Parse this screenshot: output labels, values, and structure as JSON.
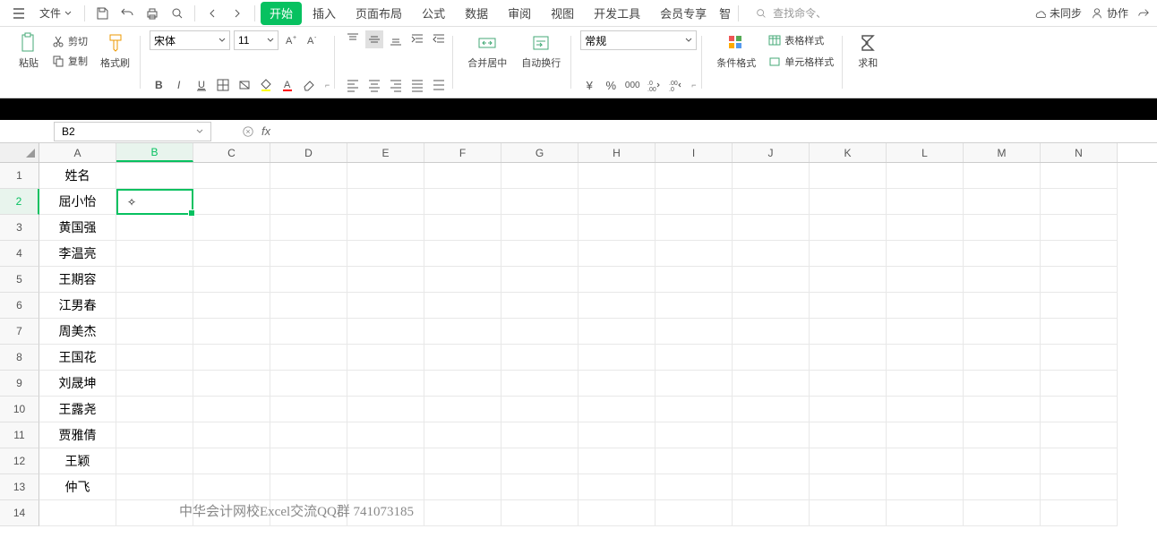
{
  "menubar": {
    "file": "文件",
    "tabs": [
      "开始",
      "插入",
      "页面布局",
      "公式",
      "数据",
      "审阅",
      "视图",
      "开发工具",
      "会员专享"
    ],
    "active_tab": 0,
    "overflow": "智",
    "search_placeholder": "查找命令、",
    "unsync": "未同步",
    "collab": "协作"
  },
  "ribbon": {
    "paste": "粘贴",
    "cut": "剪切",
    "copy": "复制",
    "format_painter": "格式刷",
    "font_name": "宋体",
    "font_size": "11",
    "merge_center": "合并居中",
    "wrap": "自动换行",
    "number_format": "常规",
    "cond_fmt": "条件格式",
    "table_style": "表格样式",
    "cell_style": "单元格样式",
    "sum": "求和"
  },
  "formula_bar": {
    "name_box": "B2",
    "fx": "fx",
    "value": ""
  },
  "grid": {
    "columns": [
      "A",
      "B",
      "C",
      "D",
      "E",
      "F",
      "G",
      "H",
      "I",
      "J",
      "K",
      "L",
      "M",
      "N"
    ],
    "active_col": "B",
    "active_row": 2,
    "rows": [
      {
        "num": 1,
        "A": "姓名"
      },
      {
        "num": 2,
        "A": "屈小怡"
      },
      {
        "num": 3,
        "A": "黄国强"
      },
      {
        "num": 4,
        "A": "李温亮"
      },
      {
        "num": 5,
        "A": "王期容"
      },
      {
        "num": 6,
        "A": "江男春"
      },
      {
        "num": 7,
        "A": "周美杰"
      },
      {
        "num": 8,
        "A": "王国花"
      },
      {
        "num": 9,
        "A": "刘晟坤"
      },
      {
        "num": 10,
        "A": "王露尧"
      },
      {
        "num": 11,
        "A": "贾雅倩"
      },
      {
        "num": 12,
        "A": "王颖"
      },
      {
        "num": 13,
        "A": "仲飞"
      },
      {
        "num": 14,
        "A": ""
      }
    ]
  },
  "watermark": "中华会计网校Excel交流QQ群 741073185"
}
